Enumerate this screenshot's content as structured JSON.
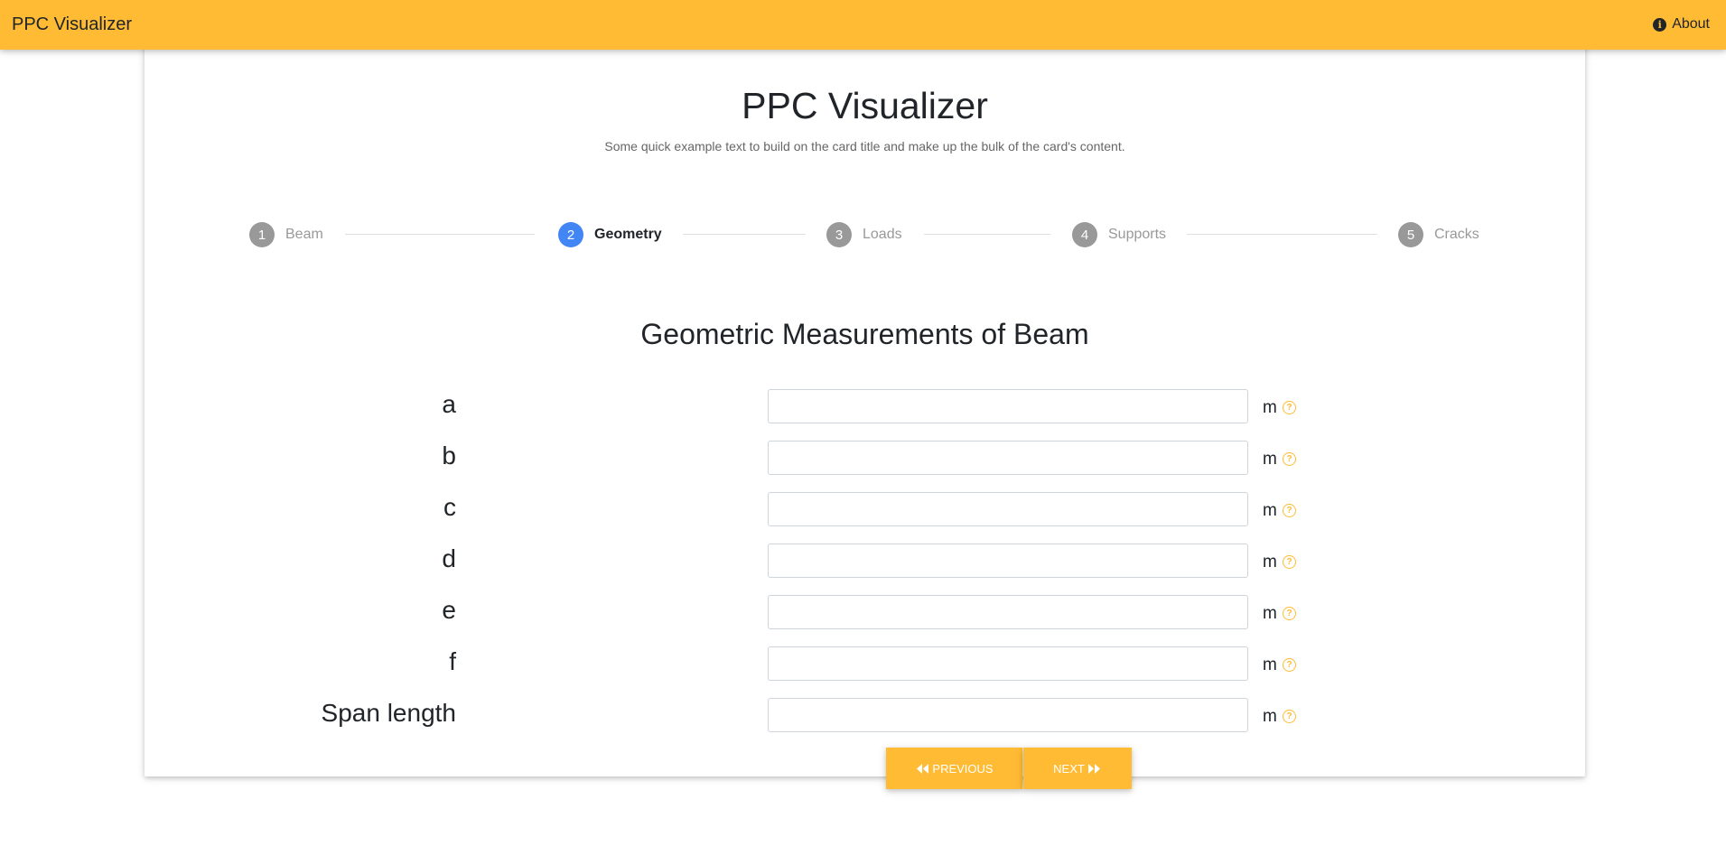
{
  "navbar": {
    "brand": "PPC Visualizer",
    "about_label": "About",
    "about_icon": "info-icon",
    "background": "#ffbb33"
  },
  "card": {
    "title": "PPC Visualizer",
    "text": "Some quick example text to build on the card title and make up the bulk of the card's content."
  },
  "stepper": {
    "steps": [
      {
        "number": "1",
        "label": "Beam",
        "active": false
      },
      {
        "number": "2",
        "label": "Geometry",
        "active": true
      },
      {
        "number": "3",
        "label": "Loads",
        "active": false
      },
      {
        "number": "4",
        "label": "Supports",
        "active": false
      },
      {
        "number": "5",
        "label": "Cracks",
        "active": false
      }
    ],
    "active_color": "#4285f4",
    "inactive_color": "#999999"
  },
  "form": {
    "title": "Geometric Measurements of Beam",
    "fields": [
      {
        "label": "a",
        "value": "",
        "placeholder": "",
        "unit": "m",
        "help_icon": "question-circle-icon"
      },
      {
        "label": "b",
        "value": "",
        "placeholder": "",
        "unit": "m",
        "help_icon": "question-circle-icon"
      },
      {
        "label": "c",
        "value": "",
        "placeholder": "",
        "unit": "m",
        "help_icon": "question-circle-icon"
      },
      {
        "label": "d",
        "value": "",
        "placeholder": "",
        "unit": "m",
        "help_icon": "question-circle-icon"
      },
      {
        "label": "e",
        "value": "",
        "placeholder": "",
        "unit": "m",
        "help_icon": "question-circle-icon"
      },
      {
        "label": "f",
        "value": "",
        "placeholder": "",
        "unit": "m",
        "help_icon": "question-circle-icon"
      },
      {
        "label": "Span length",
        "value": "",
        "placeholder": "",
        "unit": "m",
        "help_icon": "question-circle-icon"
      }
    ],
    "help_symbol": "?"
  },
  "buttons": {
    "previous_label": "Previous",
    "next_label": "Next",
    "color": "#ffbb33"
  }
}
